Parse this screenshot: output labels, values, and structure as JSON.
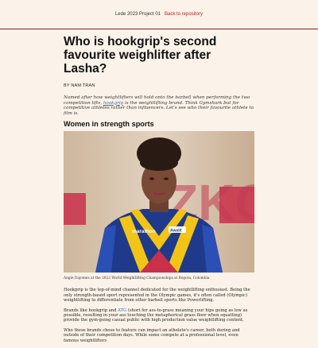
{
  "topbar": {
    "project": "Lede 2023 Project 01",
    "back_link": "Back to repository"
  },
  "article": {
    "title": "Who is hookgrip's second favourite weighlifter after Lasha?",
    "byline": "BY NAM TRAN",
    "intro": {
      "part1": "Named after how weightlifters will hold onto the barbell when performing the two competition lifts, ",
      "link": "hookgrip",
      "part2": " is the weightlifting brand. Think Gymshark but for competitive athletes rather than influencers. Let's see who their favourite athlete to film is."
    },
    "section_title": "Women in strength sports",
    "figure": {
      "banner_letters": "ZKCI",
      "jersey_text": "marathon",
      "jersey_badge": "Awalit"
    },
    "caption": "Angie Dajomes at the 2022 World Weightlifting Championships at Bogota, Colombia",
    "paragraphs": {
      "p1": "Hookgrip is the top-of-mind channel dedicated for the weightlifting enthusiast. Being the only strength-based sport represented in the Olympic games, it's often called (Olympic) weightlifting to differentiate from other barbell sports like Powerlifting.",
      "p2_a": "Brands like hookgrip and ",
      "p2_link": "ATG",
      "p2_b": " (short for ass-to-grass meaning your hips going as low as possible, resulting in your ass touching the metaphorical grass floor when squatting) provide the gym-going casual public with high production value weightlifting content.",
      "p3": "Who these brands chose to feature can impact an athelete's career, both during and outside of their competition days. While some compete at a professional level, even famous weightlifters"
    }
  },
  "colors": {
    "background": "#fbf3e9",
    "accent_red": "#b22222",
    "link_blue": "#3a6fb0",
    "jersey_blue": "#1f3a8a",
    "jersey_yellow": "#f2c417"
  }
}
